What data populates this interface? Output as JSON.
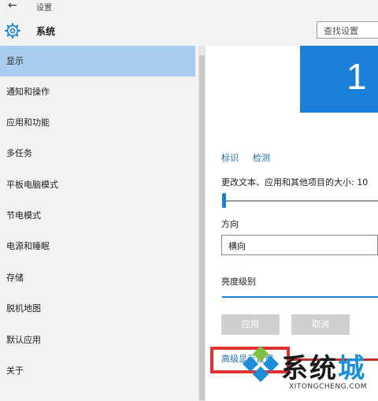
{
  "window": {
    "title": "设置"
  },
  "header": {
    "section_title": "系统",
    "search_placeholder": "查找设置"
  },
  "sidebar": {
    "items": [
      {
        "label": "显示",
        "active": true
      },
      {
        "label": "通知和操作"
      },
      {
        "label": "应用和功能"
      },
      {
        "label": "多任务"
      },
      {
        "label": "平板电脑模式"
      },
      {
        "label": "节电模式"
      },
      {
        "label": "电源和睡眠"
      },
      {
        "label": "存储"
      },
      {
        "label": "脱机地图"
      },
      {
        "label": "默认应用"
      },
      {
        "label": "关于"
      }
    ]
  },
  "main": {
    "monitor_number": "1",
    "identify_link": "标识",
    "detect_link": "检测",
    "scale_label": "更改文本、应用和其他项目的大小: 10",
    "orientation_label": "方向",
    "orientation_value": "横向",
    "brightness_label": "亮度级别",
    "apply_button": "应用",
    "cancel_button": "取消",
    "advanced_link": "高级显示设置"
  },
  "watermark": {
    "text_main": "系统",
    "text_accent": "城",
    "url": "XITONGCHENG.COM"
  },
  "colors": {
    "accent": "#1a7fd6",
    "sidebar_active": "#a9cdee",
    "highlight": "#e0322f"
  }
}
